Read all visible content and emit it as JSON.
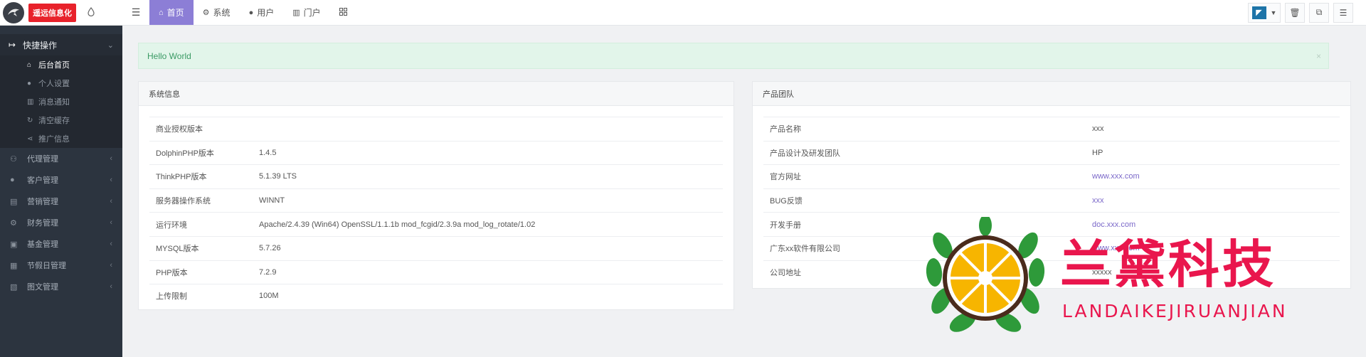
{
  "brand": {
    "name": "遥远信息化",
    "mark_icon": "dolphin-logo-icon",
    "dropdown_icon": "droplet-icon"
  },
  "sidebar": {
    "group": {
      "label": "快捷操作",
      "icon": "sign-in-icon"
    },
    "sub_items": [
      {
        "label": "后台首页",
        "icon": "home-icon"
      },
      {
        "label": "个人设置",
        "icon": "user-icon"
      },
      {
        "label": "消息通知",
        "icon": "trash-icon"
      },
      {
        "label": "清空缓存",
        "icon": "refresh-icon"
      },
      {
        "label": "推广信息",
        "icon": "share-icon"
      }
    ],
    "items": [
      {
        "label": "代理管理",
        "icon": "users-icon"
      },
      {
        "label": "客户管理",
        "icon": "user-icon"
      },
      {
        "label": "营销管理",
        "icon": "cart-icon"
      },
      {
        "label": "财务管理",
        "icon": "money-icon"
      },
      {
        "label": "基金管理",
        "icon": "money-icon"
      },
      {
        "label": "节假日管理",
        "icon": "calendar-icon"
      },
      {
        "label": "图文管理",
        "icon": "image-icon"
      }
    ]
  },
  "topbar": {
    "tabs": [
      {
        "label": "首页",
        "icon": "home-icon"
      },
      {
        "label": "系统",
        "icon": "gear-icon"
      },
      {
        "label": "用户",
        "icon": "user-icon"
      },
      {
        "label": "门户",
        "icon": "columns-icon"
      },
      {
        "label": "",
        "icon": "grid-icon"
      }
    ]
  },
  "alert": {
    "text": "Hello World",
    "close": "×"
  },
  "system_info": {
    "title": "系统信息",
    "rows": [
      {
        "key": "商业授权版本",
        "value": ""
      },
      {
        "key": "DolphinPHP版本",
        "value": "1.4.5"
      },
      {
        "key": "ThinkPHP版本",
        "value": "5.1.39 LTS"
      },
      {
        "key": "服务器操作系统",
        "value": "WINNT"
      },
      {
        "key": "运行环境",
        "value": "Apache/2.4.39 (Win64) OpenSSL/1.1.1b mod_fcgid/2.3.9a mod_log_rotate/1.02"
      },
      {
        "key": "MYSQL版本",
        "value": "5.7.26"
      },
      {
        "key": "PHP版本",
        "value": "7.2.9"
      },
      {
        "key": "上传限制",
        "value": "100M"
      }
    ]
  },
  "product_team": {
    "title": "产品团队",
    "rows": [
      {
        "key": "产品名称",
        "value": "xxx"
      },
      {
        "key": "产品设计及研发团队",
        "value": "HP"
      },
      {
        "key": "官方网址",
        "value": "www.xxx.com",
        "link": true
      },
      {
        "key": "BUG反馈",
        "value": "xxx",
        "link": true
      },
      {
        "key": "开发手册",
        "value": "doc.xxx.com",
        "link": true
      },
      {
        "key": "广东xx软件有限公司",
        "value": "www.xxx.com",
        "link": true
      },
      {
        "key": "公司地址",
        "value": "xxxxx"
      }
    ]
  },
  "watermark": {
    "title": "兰黛科技",
    "subtitle": "LANDAIKEJIRUANJIAN",
    "colors": {
      "text": "#e9164d",
      "leaf": "#2e9a3a",
      "fruit": "#f7b500"
    }
  },
  "colors": {
    "accent": "#8c7ed6",
    "sidebar": "#2c343f",
    "alert_bg": "#e2f5ea",
    "link": "#7b68c9"
  }
}
